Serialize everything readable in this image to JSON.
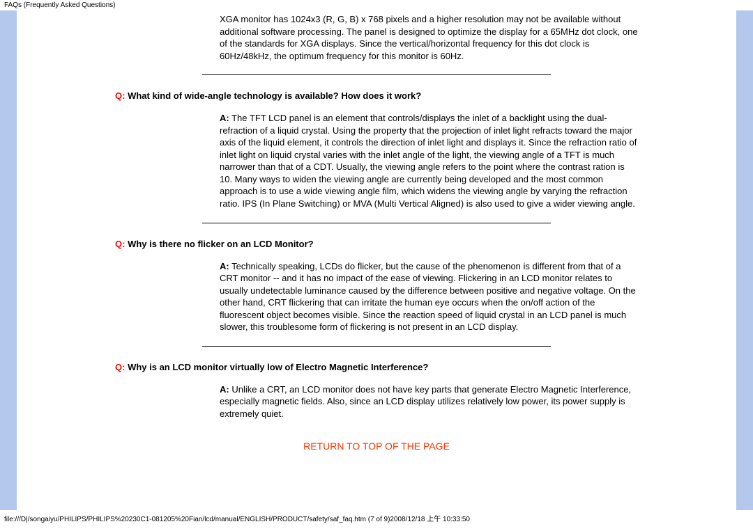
{
  "header": {
    "title": "FAQs (Frequently Asked Questions)"
  },
  "intro": "XGA monitor has 1024x3 (R, G, B) x 768 pixels and a higher resolution may not be available without additional software processing. The panel is designed to optimize the display for a 65MHz dot clock, one of the standards for XGA displays. Since the vertical/horizontal frequency for this dot clock is 60Hz/48kHz, the optimum frequency for this monitor is 60Hz.",
  "faqs": [
    {
      "q_label": "Q:",
      "question": " What kind of wide-angle technology is available? How does it work?",
      "a_label": "A:",
      "answer": " The TFT LCD panel is an element that controls/displays the inlet of a backlight using the dual-refraction of a liquid crystal. Using the property that the projection of inlet light refracts toward the major axis of the liquid element, it controls the direction of inlet light and displays it. Since the refraction ratio of inlet light on liquid crystal varies with the inlet angle of the light, the viewing angle of a TFT is much narrower than that of a CDT. Usually, the viewing angle refers to the point where the contrast ration is 10. Many ways to widen the viewing angle are currently being developed and the most common approach is to use a wide viewing angle film, which widens the viewing angle by varying the refraction ratio. IPS (In Plane Switching) or MVA (Multi Vertical Aligned) is also used to give a wider viewing angle."
    },
    {
      "q_label": "Q:",
      "question": " Why is there no flicker on an LCD Monitor?",
      "a_label": "A:",
      "answer": " Technically speaking, LCDs do flicker, but the cause of the phenomenon is different from that of a CRT monitor -- and it has no impact of the ease of viewing. Flickering in an LCD monitor relates to usually undetectable luminance caused by the difference between positive and negative voltage. On the other hand, CRT flickering that can irritate the human eye occurs when the on/off action of the fluorescent object becomes visible. Since the reaction speed of liquid crystal in an LCD panel is much slower, this troublesome form of flickering is not present in an LCD display."
    },
    {
      "q_label": "Q:",
      "question": " Why is an LCD monitor virtually low of Electro Magnetic Interference?",
      "a_label": "A:",
      "answer": " Unlike a CRT, an LCD monitor does not have key parts that generate Electro Magnetic Interference, especially magnetic fields. Also, since an LCD display utilizes relatively low power, its power supply is extremely quiet."
    }
  ],
  "return_link": "RETURN TO TOP OF THE PAGE",
  "footer": "file:///D|/songaiyu/PHILIPS/PHILIPS%20230C1-081205%20Fian/lcd/manual/ENGLISH/PRODUCT/safety/saf_faq.htm (7 of 9)2008/12/18 上午 10:33:50"
}
